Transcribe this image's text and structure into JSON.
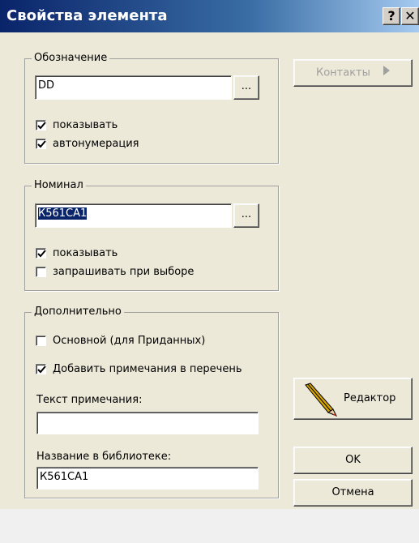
{
  "window": {
    "title": "Свойства элемента",
    "help_button": "?",
    "close_button": "✕"
  },
  "designation": {
    "legend": "Обозначение",
    "value": "DD",
    "browse_label": "...",
    "show_label": "показывать",
    "show_checked": true,
    "autonumber_label": "автонумерация",
    "autonumber_checked": true
  },
  "nominal": {
    "legend": "Номинал",
    "value": "К561СА1",
    "browse_label": "...",
    "show_label": "показывать",
    "show_checked": true,
    "ask_label": "запрашивать при выборе",
    "ask_checked": false
  },
  "extra": {
    "legend": "Дополнительно",
    "main_label": "Основной (для Приданных)",
    "main_checked": false,
    "add_notes_label": "Добавить примечания в перечень",
    "add_notes_checked": true,
    "note_text_label": "Текст примечания:",
    "note_text_value": "",
    "library_name_label": "Название в библиотеке:",
    "library_name_value": "К561СА1"
  },
  "buttons": {
    "contacts_label": "Контакты",
    "editor_label": "Редактор",
    "ok_label": "OK",
    "cancel_label": "Отмена"
  },
  "icons": {
    "contacts": "triangle-right-icon",
    "editor": "pencil-icon"
  },
  "colors": {
    "selection": "#0a246a",
    "pencil_body": "#d9a600",
    "pencil_tip": "#e03020"
  }
}
